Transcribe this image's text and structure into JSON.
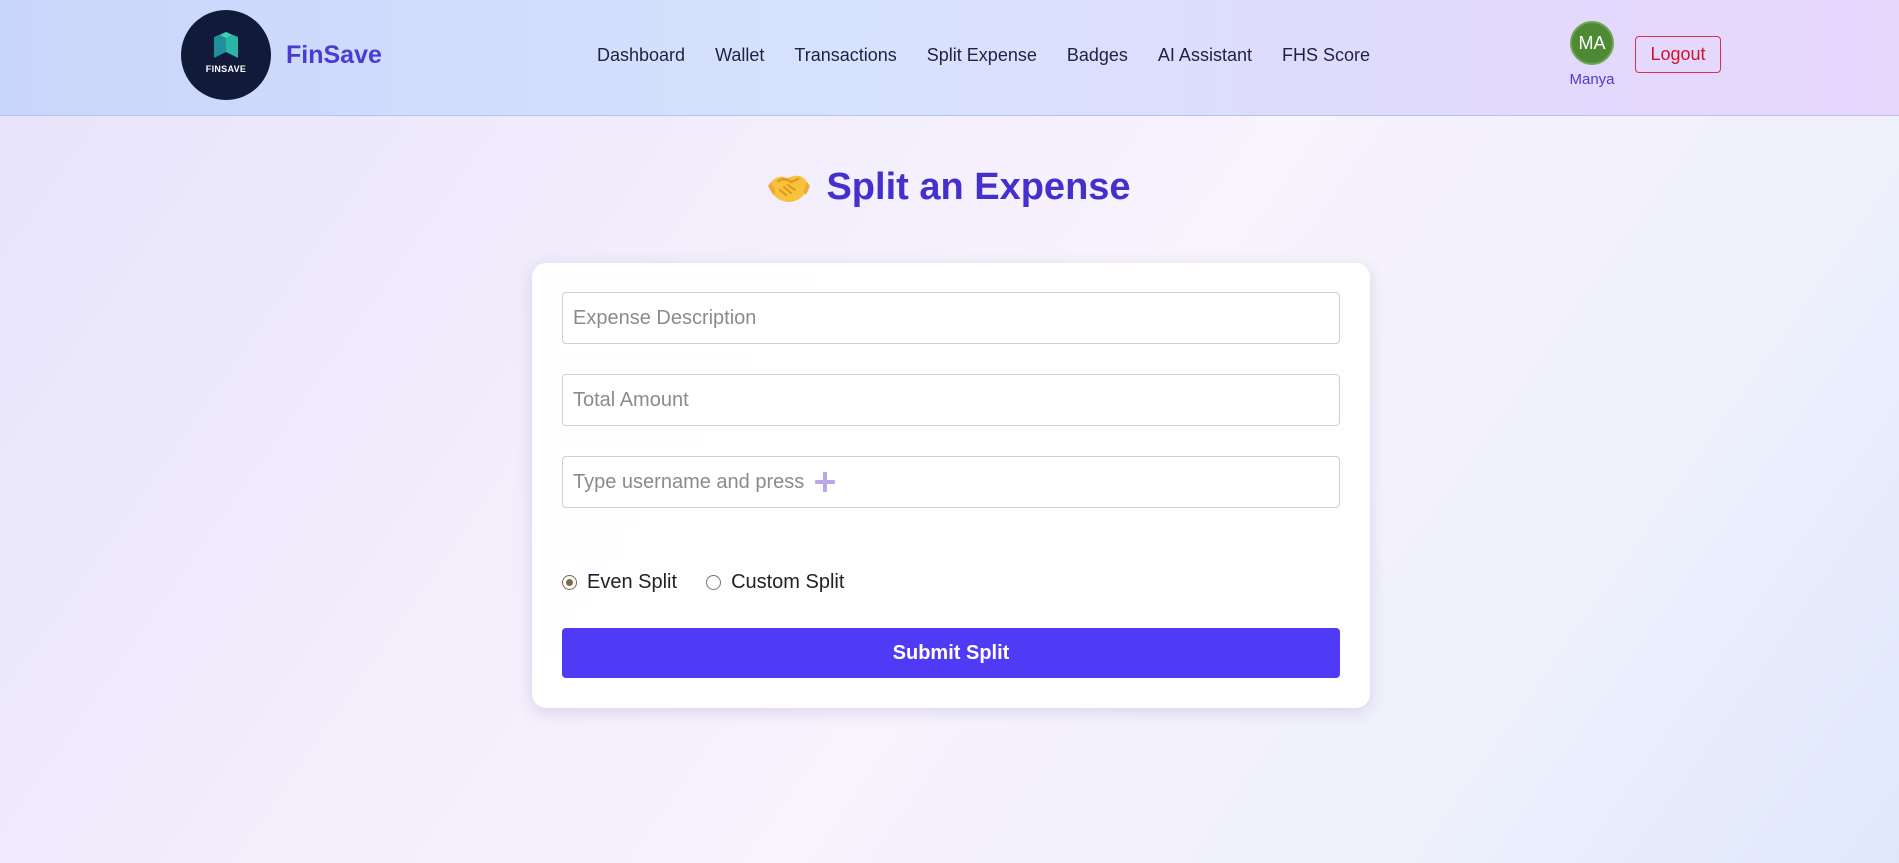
{
  "brand": {
    "name": "FinSave",
    "logo_text": "FINSAVE"
  },
  "nav": {
    "items": [
      {
        "label": "Dashboard"
      },
      {
        "label": "Wallet"
      },
      {
        "label": "Transactions"
      },
      {
        "label": "Split Expense"
      },
      {
        "label": "Badges"
      },
      {
        "label": "AI Assistant"
      },
      {
        "label": "FHS Score"
      }
    ]
  },
  "user": {
    "initials": "MA",
    "name": "Manya",
    "logout_label": "Logout"
  },
  "page": {
    "title": "Split an Expense",
    "title_icon": "handshake-icon"
  },
  "form": {
    "description_placeholder": "Expense Description",
    "amount_placeholder": "Total Amount",
    "username_placeholder": "Type username and press",
    "add_icon": "plus-icon",
    "split_options": [
      {
        "label": "Even Split",
        "checked": true
      },
      {
        "label": "Custom Split",
        "checked": false
      }
    ],
    "submit_label": "Submit Split"
  },
  "colors": {
    "accent": "#4f3bf6",
    "brand_text": "#4b3bd1",
    "title": "#4430cc",
    "logout": "#d0142c",
    "avatar": "#4d8a33"
  }
}
